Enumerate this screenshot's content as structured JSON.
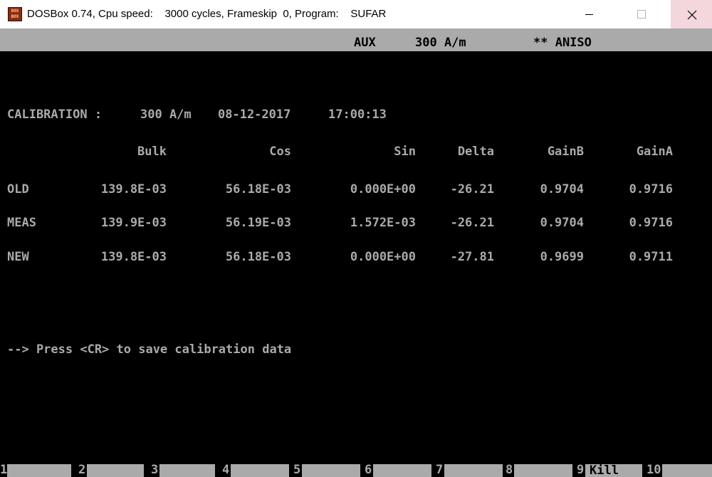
{
  "window": {
    "title": "DOSBox 0.74, Cpu speed:    3000 cycles, Frameskip  0, Program:    SUFAR",
    "icon": "dosbox-icon",
    "icon_text_top": "DOS",
    "icon_text_bottom": "BOX",
    "controls": [
      "minimize-icon",
      "maximize-icon",
      "close-icon"
    ]
  },
  "status": {
    "aux": "AUX",
    "field": "300 A/m",
    "mode": "** ANISO"
  },
  "calibration": {
    "label": "CALIBRATION :",
    "field": "300 A/m",
    "date": "08-12-2017",
    "time": "17:00:13"
  },
  "table": {
    "columns": [
      "Bulk",
      "Cos",
      "Sin",
      "Delta",
      "GainB",
      "GainA"
    ],
    "rows": [
      {
        "label": "OLD",
        "values": [
          "139.8E-03",
          "56.18E-03",
          "0.000E+00",
          "-26.21",
          "0.9704",
          "0.9716"
        ]
      },
      {
        "label": "MEAS",
        "values": [
          "139.9E-03",
          "56.19E-03",
          "1.572E-03",
          "-26.21",
          "0.9704",
          "0.9716"
        ]
      },
      {
        "label": "NEW",
        "values": [
          "139.8E-03",
          "56.18E-03",
          "0.000E+00",
          "-27.81",
          "0.9699",
          "0.9711"
        ]
      }
    ]
  },
  "prompt": "--> Press <CR> to save calibration data",
  "function_keys": [
    {
      "number": "1",
      "label": ""
    },
    {
      "number": "2",
      "label": ""
    },
    {
      "number": "3",
      "label": ""
    },
    {
      "number": "4",
      "label": ""
    },
    {
      "number": "5",
      "label": ""
    },
    {
      "number": "6",
      "label": ""
    },
    {
      "number": "7",
      "label": ""
    },
    {
      "number": "8",
      "label": ""
    },
    {
      "number": "9",
      "label": "Kill"
    },
    {
      "number": "10",
      "label": ""
    }
  ],
  "colors": {
    "screen_bg": "#000000",
    "text": "#aaaaaa",
    "status_bar": "#aaaaaa",
    "titlebar": "#ffffff",
    "close_hover": "#f3d7dc"
  }
}
